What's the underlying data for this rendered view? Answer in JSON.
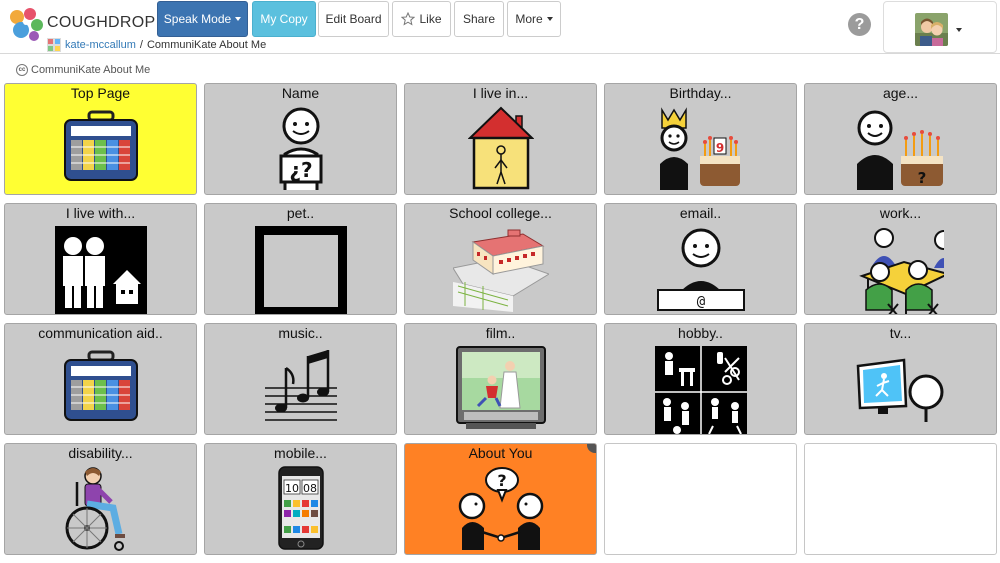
{
  "app": {
    "brand": "COUGHDROP",
    "breadcrumb": {
      "user": "kate-mccallum",
      "separator": "/",
      "board": "CommuniKate About Me"
    }
  },
  "toolbar": {
    "speak_mode": "Speak Mode",
    "my_copy": "My Copy",
    "edit_board": "Edit Board",
    "like": "Like",
    "share": "Share",
    "more": "More"
  },
  "header_right": {
    "help": "?"
  },
  "board": {
    "license_icon": "cc",
    "title": "CommuniKate About Me",
    "buttons": [
      {
        "label": "Top Page",
        "icon": "communication-device-icon"
      },
      {
        "label": "Name",
        "icon": "person-question-icon"
      },
      {
        "label": "I live in...",
        "icon": "house-icon"
      },
      {
        "label": "Birthday...",
        "icon": "birthday-king-cake-icon"
      },
      {
        "label": "age...",
        "icon": "age-cake-icon"
      },
      {
        "label": "I live with...",
        "icon": "family-house-icon"
      },
      {
        "label": "pet..",
        "icon": "empty-frame-icon"
      },
      {
        "label": "School college...",
        "icon": "school-building-icon"
      },
      {
        "label": "email..",
        "icon": "person-email-icon"
      },
      {
        "label": "work...",
        "icon": "work-meeting-icon"
      },
      {
        "label": "communication aid..",
        "icon": "communication-device-icon"
      },
      {
        "label": "music..",
        "icon": "music-notes-icon"
      },
      {
        "label": "film..",
        "icon": "film-tv-icon"
      },
      {
        "label": "hobby..",
        "icon": "hobby-grid-icon"
      },
      {
        "label": "tv...",
        "icon": "tv-watching-icon"
      },
      {
        "label": "disability...",
        "icon": "wheelchair-icon"
      },
      {
        "label": "mobile...",
        "icon": "mobile-phone-icon"
      },
      {
        "label": "About You",
        "icon": "two-people-talking-icon"
      },
      {
        "label": "",
        "icon": ""
      },
      {
        "label": "",
        "icon": ""
      }
    ],
    "phone_time": {
      "hours": "10",
      "minutes": "08"
    },
    "email_placeholder": "___@___",
    "colors": {
      "yellow": "#ffff33",
      "orange": "#ff8124",
      "gray": "#c9c9c9",
      "blue": "#3c74b1",
      "cyan": "#5bc0de"
    }
  }
}
